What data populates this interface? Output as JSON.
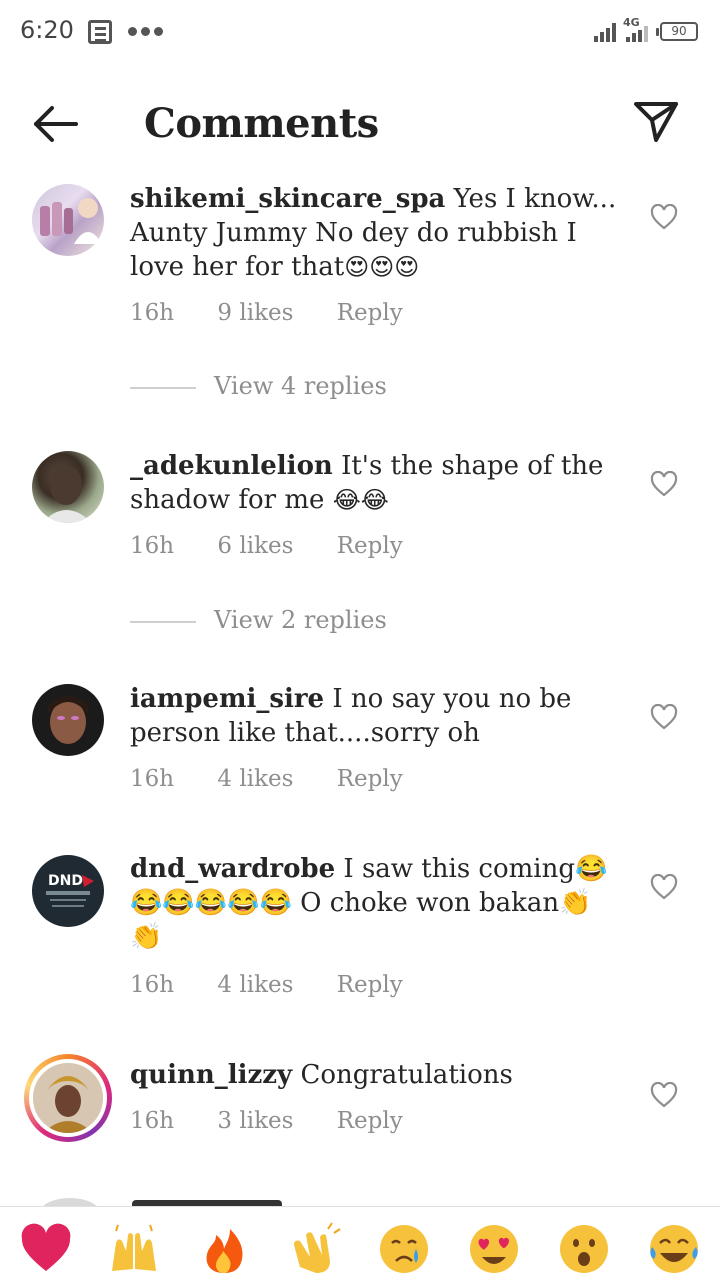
{
  "status_bar": {
    "time": "6:20",
    "network": "4G",
    "battery": "90"
  },
  "header": {
    "title": "Comments"
  },
  "comments": [
    {
      "username": "shikemi_skincare_spa",
      "text": "Yes I know... Aunty Jummy No dey do rubbish I love her for that",
      "emoji": "😍😍😍",
      "time": "16h",
      "likes": "9 likes",
      "reply": "Reply",
      "view_replies": "View 4 replies"
    },
    {
      "username": "_adekunlelion",
      "text": "It's the shape of the shadow for me",
      "emoji": "😂😂",
      "time": "16h",
      "likes": "6 likes",
      "reply": "Reply",
      "view_replies": "View 2 replies"
    },
    {
      "username": "iampemi_sire",
      "text": "I no say you no be person like that....sorry oh",
      "time": "16h",
      "likes": "4 likes",
      "reply": "Reply"
    },
    {
      "username": "dnd_wardrobe",
      "text": "I saw this coming😂😂😂😂😂😂 O choke won bakan👏👏",
      "time": "16h",
      "likes": "4 likes",
      "reply": "Reply"
    },
    {
      "username": "quinn_lizzy",
      "text": "Congratulations",
      "time": "16h",
      "likes": "3 likes",
      "reply": "Reply"
    }
  ],
  "avatar_logo": "DND",
  "reactions": [
    "red-heart",
    "raising-hands",
    "fire",
    "clapping-hands",
    "crying-face",
    "heart-eyes",
    "astonished-face",
    "tears-of-joy"
  ],
  "colors": {
    "muted": "#8e8e8e",
    "text": "#262626",
    "heart_red": "#e0245e"
  }
}
